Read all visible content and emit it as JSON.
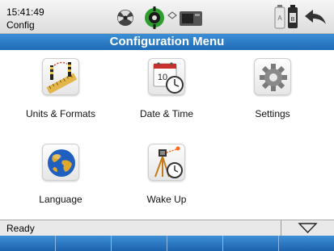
{
  "status_bar": {
    "time": "15:41:49",
    "app_name": "Config"
  },
  "title": "Configuration Menu",
  "menu_items": [
    {
      "label": "Units & Formats",
      "icon": "units-formats-icon"
    },
    {
      "label": "Date & Time",
      "icon": "calendar-clock-icon"
    },
    {
      "label": "Settings",
      "icon": "gear-icon"
    },
    {
      "label": "Language",
      "icon": "globe-icon"
    },
    {
      "label": "Wake Up",
      "icon": "wake-up-icon"
    }
  ],
  "calendar_day": "10",
  "footer": {
    "status": "Ready"
  },
  "colors": {
    "accent_blue": "#2a7bc8",
    "globe_blue": "#1f5fbf",
    "globe_land": "#e0a82a",
    "wake_orange": "#ff6a1f"
  }
}
